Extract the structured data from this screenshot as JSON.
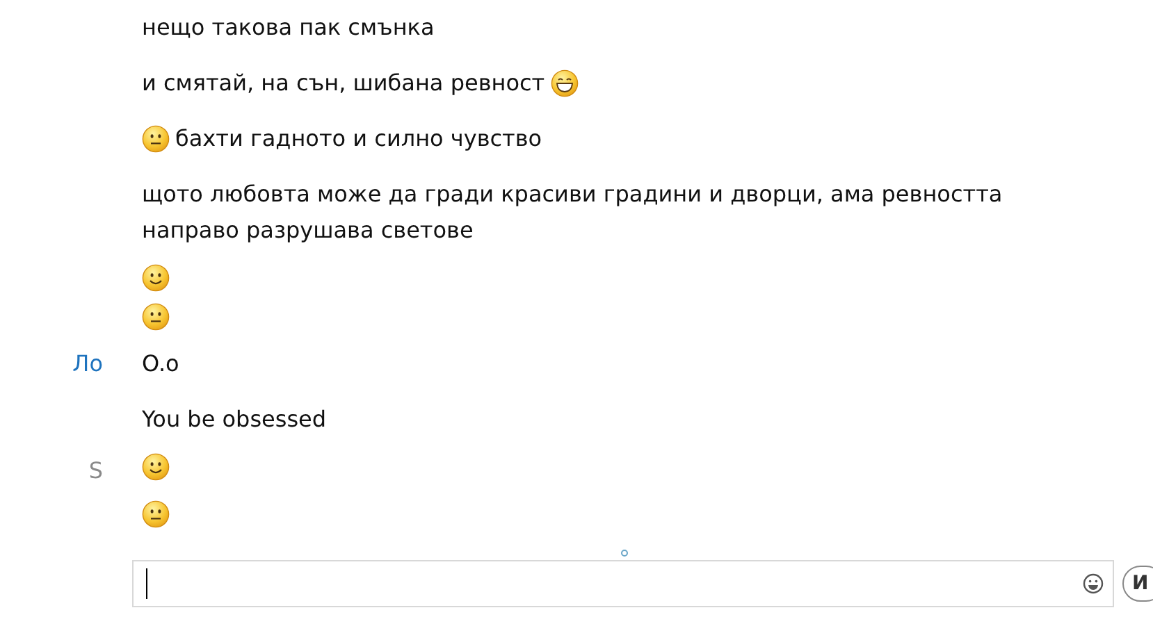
{
  "messages": [
    {
      "parts": [
        {
          "kind": "text",
          "text": "нещо такова пак смънка"
        }
      ]
    },
    {
      "parts": [
        {
          "kind": "text",
          "text": "и смятай, на сън, шибана ревност"
        },
        {
          "kind": "laugh"
        }
      ]
    },
    {
      "parts": [
        {
          "kind": "neutral"
        },
        {
          "kind": "text",
          "text": "бахти гадното и силно чувство"
        }
      ]
    },
    {
      "parts": [
        {
          "kind": "text",
          "text": "щото любовта може да гради красиви градини и дворци, ама ревността направо разрушава светове"
        }
      ]
    },
    {
      "parts": [
        {
          "kind": "smile"
        }
      ]
    },
    {
      "parts": [
        {
          "kind": "neutral"
        }
      ]
    },
    {
      "sender": "Ло",
      "color": "#1e73be",
      "parts": [
        {
          "kind": "text",
          "text": "O.o"
        }
      ]
    },
    {
      "parts": [
        {
          "kind": "text",
          "text": "You be obsessed"
        }
      ]
    },
    {
      "sender": "S",
      "color": "#8a8a8a",
      "parts": [
        {
          "kind": "smile"
        }
      ]
    },
    {
      "parts": [
        {
          "kind": "neutral"
        }
      ]
    }
  ],
  "composer": {
    "button": "И"
  }
}
